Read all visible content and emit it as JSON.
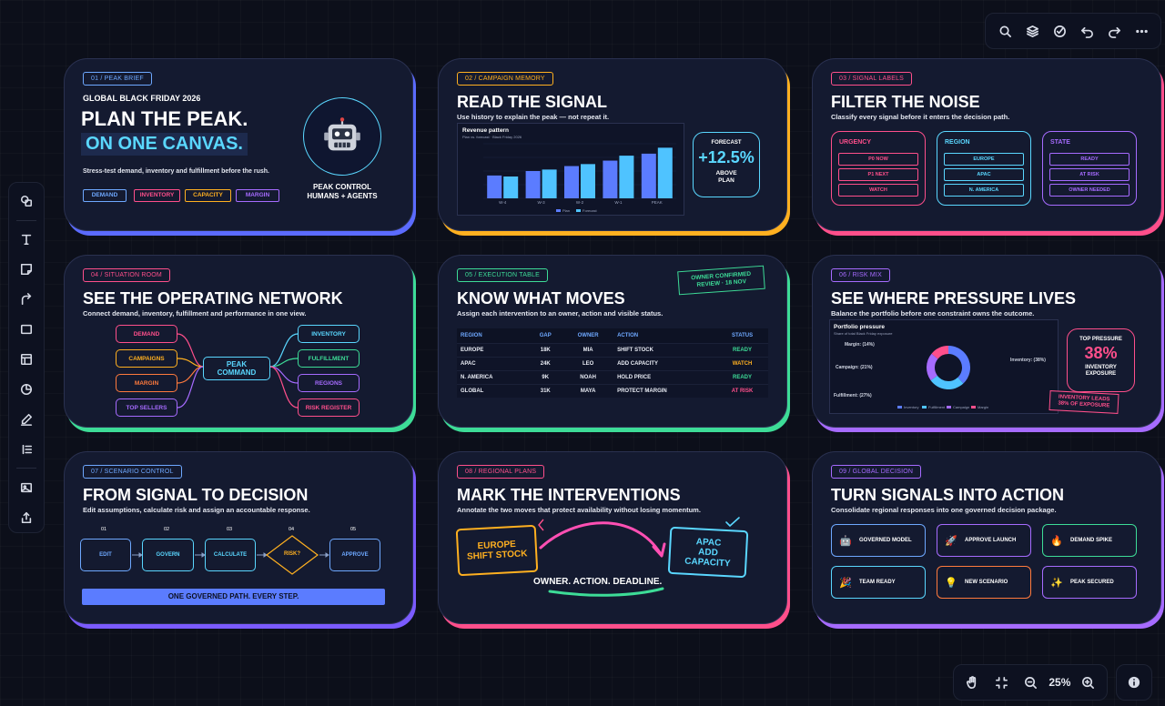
{
  "toolbar_top": {
    "icons": [
      "search-icon",
      "layers-icon",
      "check-circle-icon",
      "undo-icon",
      "redo-icon",
      "more-icon"
    ]
  },
  "toolbar_left": {
    "icons": [
      "shapes-icon",
      "text-icon",
      "sticky-note-icon",
      "connector-icon",
      "frame-icon",
      "table-icon",
      "chart-icon",
      "pen-icon",
      "list-icon",
      "image-icon",
      "export-icon"
    ]
  },
  "toolbar_bottom": {
    "zoom": "25%"
  },
  "colors": {
    "blue": "#6ea8ff",
    "pink": "#ff4f8b",
    "orange": "#ffb020",
    "purple": "#a66bff",
    "green": "#3ddc97",
    "cyan": "#5ad7ff"
  },
  "card1": {
    "tag": "01 / PEAK BRIEF",
    "kicker": "GLOBAL BLACK FRIDAY 2026",
    "title1": "PLAN THE PEAK.",
    "title2": "ON ONE CANVAS.",
    "sub": "Stress-test demand, inventory and fulfillment before the rush.",
    "chips": [
      "DEMAND",
      "INVENTORY",
      "CAPACITY",
      "MARGIN"
    ],
    "robot_label": "PEAK CONTROL\nHUMANS + AGENTS"
  },
  "card2": {
    "tag": "02 / CAMPAIGN MEMORY",
    "title": "READ THE SIGNAL",
    "sub": "Use history to explain the peak — not repeat it.",
    "chart_title": "Revenue pattern",
    "chart_subtitle": "Plan vs. forecast · Black Friday 2026",
    "forecast_label": "FORECAST",
    "forecast_value": "+12.5%",
    "forecast_caption": "ABOVE\nPLAN"
  },
  "chart_data": {
    "type": "bar",
    "title": "Revenue pattern",
    "subtitle": "Plan vs. forecast · Black Friday 2026",
    "categories": [
      "W-4",
      "W-3",
      "W-2",
      "W-1",
      "PEAK"
    ],
    "series": [
      {
        "name": "Plan",
        "values": [
          46,
          55,
          65,
          76,
          90
        ],
        "color": "#5b7cff"
      },
      {
        "name": "Forecast",
        "values": [
          44,
          58,
          69,
          86,
          102
        ],
        "color": "#4fc3ff"
      }
    ],
    "ylim": [
      0,
      110
    ],
    "grid": true,
    "legend": "bottom"
  },
  "card3": {
    "tag": "03 / SIGNAL LABELS",
    "title": "FILTER THE NOISE",
    "sub": "Classify every signal before it enters the decision path.",
    "groups": [
      {
        "name": "URGENCY",
        "items": [
          "P0 NOW",
          "P1 NEXT",
          "WATCH"
        ]
      },
      {
        "name": "REGION",
        "items": [
          "EUROPE",
          "APAC",
          "N. AMERICA"
        ]
      },
      {
        "name": "STATE",
        "items": [
          "READY",
          "AT RISK",
          "OWNER NEEDED"
        ]
      }
    ]
  },
  "card4": {
    "tag": "04 / SITUATION ROOM",
    "title": "SEE THE OPERATING NETWORK",
    "sub": "Connect demand, inventory, fulfillment and performance in one view.",
    "center": "PEAK\nCOMMAND",
    "left": [
      "DEMAND",
      "CAMPAIGNS",
      "MARGIN",
      "TOP SELLERS"
    ],
    "right": [
      "INVENTORY",
      "FULFILLMENT",
      "REGIONS",
      "RISK REGISTER"
    ]
  },
  "card5": {
    "tag": "05 / EXECUTION TABLE",
    "title": "KNOW WHAT MOVES",
    "sub": "Assign each intervention to an owner, action and visible status.",
    "stamp": "OWNER CONFIRMED\nREVIEW · 18 NOV",
    "headers": [
      "REGION",
      "GAP",
      "OWNER",
      "ACTION",
      "STATUS"
    ],
    "rows": [
      {
        "region": "EUROPE",
        "gap": "18K",
        "owner": "MIA",
        "action": "SHIFT STOCK",
        "status": "READY",
        "color": "#3ddc97"
      },
      {
        "region": "APAC",
        "gap": "24K",
        "owner": "LEO",
        "action": "ADD CAPACITY",
        "status": "WATCH",
        "color": "#ffb020"
      },
      {
        "region": "N. AMERICA",
        "gap": "9K",
        "owner": "NOAH",
        "action": "HOLD PRICE",
        "status": "READY",
        "color": "#3ddc97"
      },
      {
        "region": "GLOBAL",
        "gap": "31K",
        "owner": "MAYA",
        "action": "PROTECT MARGIN",
        "status": "AT RISK",
        "color": "#ff4f8b"
      }
    ]
  },
  "card6": {
    "tag": "06 / RISK MIX",
    "title": "SEE WHERE PRESSURE LIVES",
    "sub": "Balance the portfolio before one constraint owns the outcome.",
    "donut_title": "Portfolio pressure",
    "donut_subtitle": "Share of total Black Friday exposure",
    "slices": [
      {
        "name": "Inventory",
        "value": 38,
        "label": "Inventory: (38%)",
        "color": "#5b7cff"
      },
      {
        "name": "Fulfillment",
        "value": 27,
        "label": "Fulfillment: (27%)",
        "color": "#4fc3ff"
      },
      {
        "name": "Campaign",
        "value": 21,
        "label": "Campaign: (21%)",
        "color": "#a66bff"
      },
      {
        "name": "Margin",
        "value": 14,
        "label": "Margin: (14%)",
        "color": "#ff4f8b"
      }
    ],
    "pressure_label": "TOP PRESSURE",
    "pressure_value": "38%",
    "pressure_caption": "INVENTORY\nEXPOSURE",
    "stamp": "INVENTORY LEADS\n38% OF EXPOSURE"
  },
  "card7": {
    "tag": "07 / SCENARIO CONTROL",
    "title": "FROM SIGNAL TO DECISION",
    "sub": "Edit assumptions, calculate risk and assign an accountable response.",
    "steps": [
      {
        "num": "01",
        "label": "EDIT"
      },
      {
        "num": "02",
        "label": "GOVERN"
      },
      {
        "num": "03",
        "label": "CALCULATE"
      },
      {
        "num": "04",
        "label": "RISK?"
      },
      {
        "num": "05",
        "label": "APPROVE"
      }
    ],
    "banner": "ONE GOVERNED PATH. EVERY STEP."
  },
  "card8": {
    "tag": "08 / REGIONAL PLANS",
    "title": "MARK THE INTERVENTIONS",
    "sub": "Annotate the two moves that protect availability without losing momentum.",
    "left_note": "EUROPE\nSHIFT STOCK",
    "right_note": "APAC\nADD\nCAPACITY",
    "caption": "OWNER. ACTION. DEADLINE."
  },
  "card9": {
    "tag": "09 / GLOBAL DECISION",
    "title": "TURN SIGNALS INTO ACTION",
    "sub": "Consolidate regional responses into one governed decision package.",
    "items": [
      {
        "label": "GOVERNED MODEL",
        "icon": "robot-icon",
        "glyph": "🤖",
        "color": "#6ea8ff"
      },
      {
        "label": "APPROVE LAUNCH",
        "icon": "rocket-icon",
        "glyph": "🚀",
        "color": "#a66bff"
      },
      {
        "label": "DEMAND SPIKE",
        "icon": "flame-icon",
        "glyph": "🔥",
        "color": "#3ddc97"
      },
      {
        "label": "TEAM READY",
        "icon": "party-icon",
        "glyph": "🎉",
        "color": "#5ad7ff"
      },
      {
        "label": "NEW SCENARIO",
        "icon": "bulb-icon",
        "glyph": "💡",
        "color": "#ff7a3d"
      },
      {
        "label": "PEAK SECURED",
        "icon": "sparkle-icon",
        "glyph": "✨",
        "color": "#a66bff"
      }
    ]
  }
}
